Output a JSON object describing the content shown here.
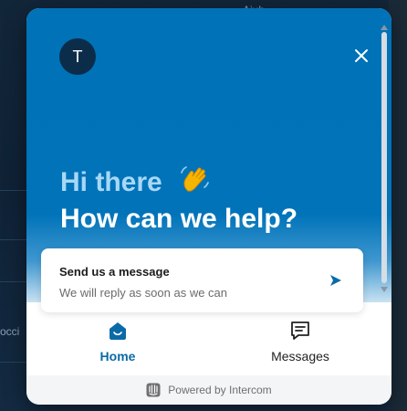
{
  "background": {
    "top_fragment": "Aiub",
    "left_fragment": "occi"
  },
  "widget": {
    "avatar_initial": "T",
    "close_icon": "close-icon",
    "greeting_line1": "Hi there",
    "greeting_emoji": "wave-emoji",
    "greeting_line2": "How can we help?",
    "message_card": {
      "title": "Send us a message",
      "subtitle": "We will reply as soon as we can",
      "icon": "send-arrow-icon"
    },
    "nav": {
      "items": [
        {
          "label": "Home",
          "icon": "home-icon",
          "active": true
        },
        {
          "label": "Messages",
          "icon": "messages-icon",
          "active": false
        }
      ]
    },
    "footer": {
      "text": "Powered by Intercom",
      "icon": "intercom-logo-icon"
    }
  },
  "colors": {
    "brand_blue": "#0073b9",
    "greeting_light": "#a8d8f5",
    "active_nav": "#0a6aa8",
    "avatar_bg": "#0c2d4a"
  }
}
